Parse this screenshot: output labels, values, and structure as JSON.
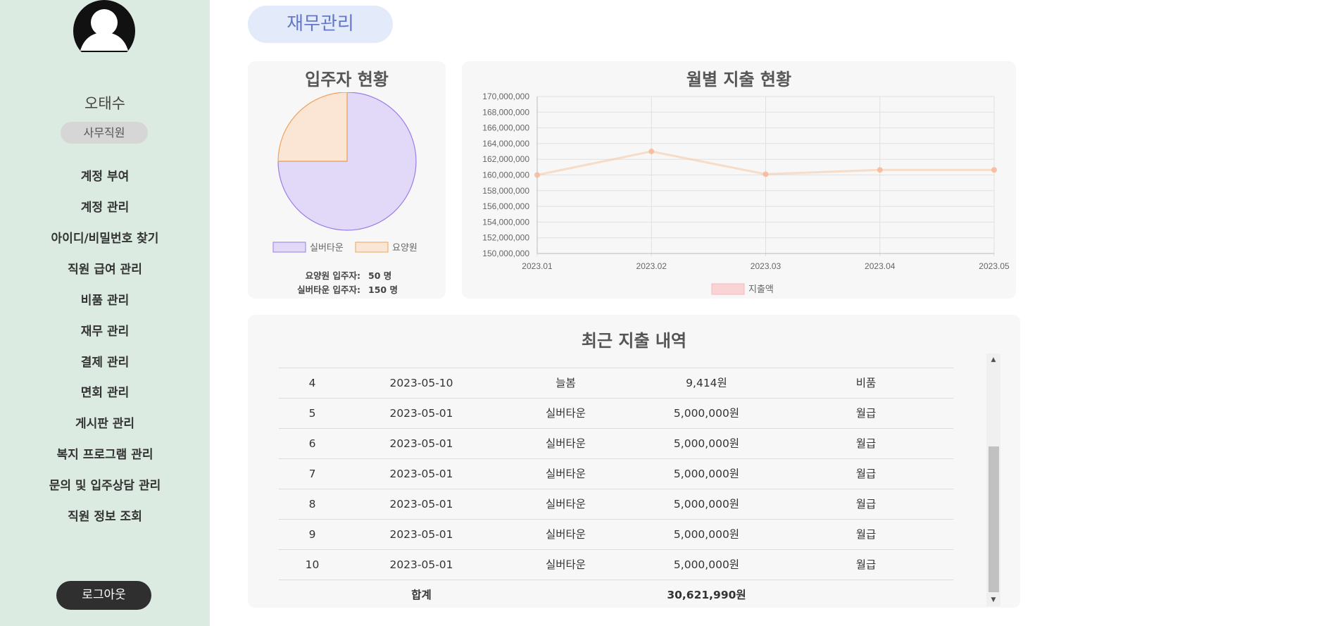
{
  "sidebar": {
    "user_name": "오태수",
    "role": "사무직원",
    "nav_items": [
      {
        "label": "계정 부여"
      },
      {
        "label": "계정 관리"
      },
      {
        "label": "아이디/비밀번호 찾기"
      },
      {
        "label": "직원 급여 관리"
      },
      {
        "label": "비품 관리"
      },
      {
        "label": "재무 관리"
      },
      {
        "label": "결제 관리"
      },
      {
        "label": "면회 관리"
      },
      {
        "label": "게시판 관리"
      },
      {
        "label": "복지 프로그램 관리"
      },
      {
        "label": "문의 및 입주상담 관리"
      },
      {
        "label": "직원 정보 조회"
      }
    ],
    "logout_label": "로그아웃"
  },
  "page_title": "재무관리",
  "residents": {
    "title": "입주자 현황",
    "stats": [
      {
        "label": "요양원 입주자:",
        "value": "50 명"
      },
      {
        "label": "실버타운 입주자:",
        "value": "150 명"
      }
    ]
  },
  "expenses_chart": {
    "title": "월별 지출 현황"
  },
  "chart_data": [
    {
      "type": "pie",
      "title": "입주자 현황",
      "categories": [
        "실버타운",
        "요양원"
      ],
      "values": [
        150,
        50
      ],
      "colors": [
        "#e2d9f9",
        "#fbe6d5"
      ],
      "border_colors": [
        "#9b7be8",
        "#efa15b"
      ],
      "legend": "bottom"
    },
    {
      "type": "line",
      "title": "월별 지출 현황",
      "x": [
        "2023.01",
        "2023.02",
        "2023.03",
        "2023.04",
        "2023.05"
      ],
      "series": [
        {
          "name": "지출액",
          "values": [
            160000000,
            163000000,
            160100000,
            160650000,
            160650000
          ],
          "color": "#f6c9a9"
        }
      ],
      "ylim": [
        150000000,
        170000000
      ],
      "yticks": [
        "150,000,000",
        "152,000,000",
        "154,000,000",
        "156,000,000",
        "158,000,000",
        "160,000,000",
        "162,000,000",
        "164,000,000",
        "166,000,000",
        "168,000,000",
        "170,000,000"
      ],
      "grid": true,
      "legend": "bottom"
    }
  ],
  "recent_expenses": {
    "title": "최근 지출 내역",
    "rows": [
      {
        "no": "4",
        "date": "2023-05-10",
        "place": "늘봄",
        "amount": "9,414원",
        "category": "비품"
      },
      {
        "no": "5",
        "date": "2023-05-01",
        "place": "실버타운",
        "amount": "5,000,000원",
        "category": "월급"
      },
      {
        "no": "6",
        "date": "2023-05-01",
        "place": "실버타운",
        "amount": "5,000,000원",
        "category": "월급"
      },
      {
        "no": "7",
        "date": "2023-05-01",
        "place": "실버타운",
        "amount": "5,000,000원",
        "category": "월급"
      },
      {
        "no": "8",
        "date": "2023-05-01",
        "place": "실버타운",
        "amount": "5,000,000원",
        "category": "월급"
      },
      {
        "no": "9",
        "date": "2023-05-01",
        "place": "실버타운",
        "amount": "5,000,000원",
        "category": "월급"
      },
      {
        "no": "10",
        "date": "2023-05-01",
        "place": "실버타운",
        "amount": "5,000,000원",
        "category": "월급"
      }
    ],
    "total_label": "합계",
    "total_value": "30,621,990원"
  },
  "icons": {
    "avatar": "user-silhouette-icon",
    "scroll_up": "triangle-up-icon",
    "scroll_down": "triangle-down-icon"
  }
}
